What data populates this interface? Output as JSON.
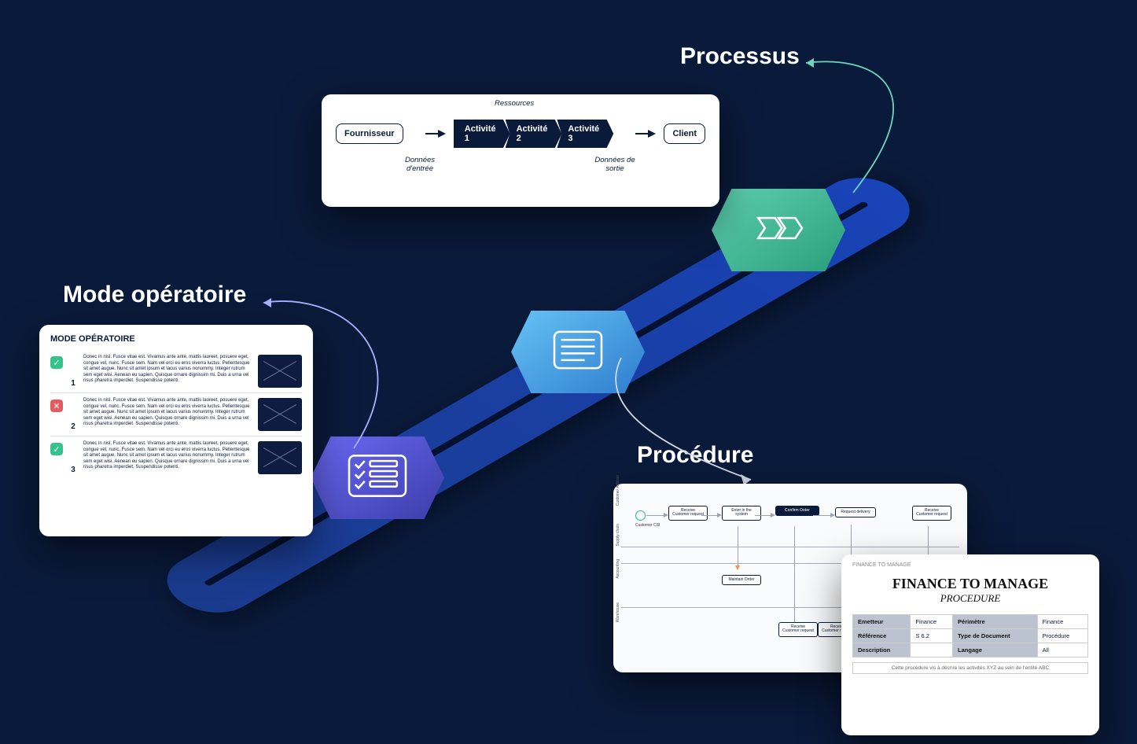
{
  "titles": {
    "processus": "Processus",
    "mode": "Mode opératoire",
    "procedure": "Procédure"
  },
  "processus_card": {
    "ressources": "Ressources",
    "fournisseur": "Fournisseur",
    "activites": [
      "Activité 1",
      "Activité 2",
      "Activité 3"
    ],
    "client": "Client",
    "entree": "Données d'entrée",
    "sortie": "Données de sortie"
  },
  "mode_card": {
    "header": "MODE OPÉRATOIRE",
    "rows": [
      {
        "ok": true,
        "num": "1",
        "text": "Donec in nisl. Fusce vitae est. Vivamus ante ante, mattis laoreet, posuere eget, congue vel, nunc. Fusce sem. Nam vel orci eu eros viverra luctus. Pellentesque sit amet augue. Nunc sit amet ipsum et lacus varius nonummy. Integer rutrum sem eget wisi. Aenean eu sapien. Quisque ornare dignissim mi. Duis a urna vel risus pharetra imperdiet. Suspendisse potenti."
      },
      {
        "ok": false,
        "num": "2",
        "text": "Donec in nisl. Fusce vitae est. Vivamus ante ante, mattis laoreet, posuere eget, congue vel, nunc. Fusce sem. Nam vel orci eu eros viverra luctus. Pellentesque sit amet augue. Nunc sit amet ipsum et lacus varius nonummy. Integer rutrum sem eget wisi. Aenean eu sapien. Quisque ornare dignissim mi. Duis a urna vel risus pharetra imperdiet. Suspendisse potenti."
      },
      {
        "ok": true,
        "num": "3",
        "text": "Donec in nisl. Fusce vitae est. Vivamus ante ante, mattis laoreet, posuere eget, congue vel, nunc. Fusce sem. Nam vel orci eu eros viverra luctus. Pellentesque sit amet augue. Nunc sit amet ipsum et lacus varius nonummy. Integer rutrum sem eget wisi. Aenean eu sapien. Quisque ornare dignissim mi. Duis a urna vel risus pharetra imperdiet. Suspendisse potenti."
      }
    ]
  },
  "procedure_card": {
    "lanes": [
      "Customer Advisor",
      "Supply chain",
      "Accounting",
      "Warehouse"
    ],
    "nodes": {
      "start": "Customer CSI",
      "n1": "Receive Customer request",
      "n2": "Enter in the system",
      "n3": "Confirm Order",
      "n4": "Request delivery",
      "n5": "Receive Customer request",
      "m1": "Maintain Order",
      "w1": "Receive Customer request",
      "w2": "Receive Customer request"
    }
  },
  "finance_card": {
    "small_head": "FINANCE TO MANAGE",
    "title": "FINANCE TO MANAGE",
    "subtitle": "PROCEDURE",
    "rows": [
      {
        "k1": "Emetteur",
        "v1": "Finance",
        "k2": "Périmètre",
        "v2": "Finance"
      },
      {
        "k1": "Référence",
        "v1": "S 6.2",
        "k2": "Type de Document",
        "v2": "Procédure"
      },
      {
        "k1": "Description",
        "v1": "",
        "k2": "Langage",
        "v2": "All"
      }
    ],
    "footer": "Cette procédure vis à décrire les activités XYZ au sein de l'entité ABC"
  }
}
